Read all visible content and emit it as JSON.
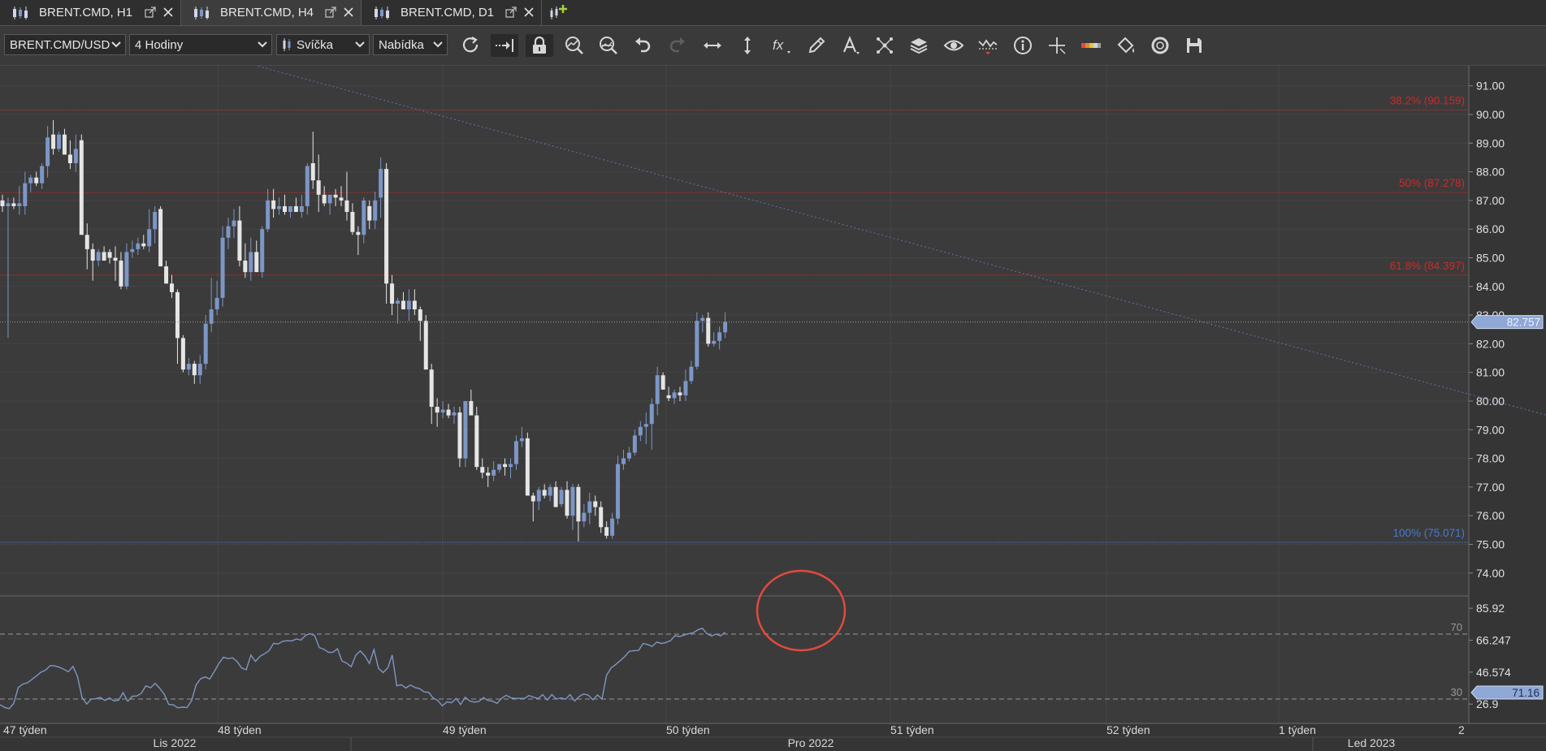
{
  "tabs": [
    {
      "label": "BRENT.CMD, H1",
      "active": false
    },
    {
      "label": "BRENT.CMD, H4",
      "active": true
    },
    {
      "label": "BRENT.CMD, D1",
      "active": false
    }
  ],
  "toolbar": {
    "instrument": "BRENT.CMD/USD",
    "period": "4 Hodiny",
    "chart_type": "Svíčka",
    "price_side": "Nabídka",
    "icons": [
      "refresh-icon",
      "autoshift-icon",
      "lock-icon",
      "zoom-in-icon",
      "zoom-out-icon",
      "undo-icon",
      "redo-icon",
      "horizontal-scale-icon",
      "vertical-scale-icon",
      "indicator-fx-icon",
      "pencil-icon",
      "text-tool-icon",
      "pattern-icon",
      "layers-icon",
      "eye-icon",
      "alert-icon",
      "info-icon",
      "crosshair-icon",
      "color-bar-icon",
      "paint-bucket-icon",
      "screenshot-icon",
      "save-icon"
    ]
  },
  "colors": {
    "background": "#3b3b3b",
    "bull_candle": "#7c96c6",
    "bear_candle": "#e5e5e5",
    "fib_red": "#cc2a2a",
    "fib_blue": "#4a78d1",
    "price_tag": "#8fa8d6",
    "annotation_circle": "#e04a3f",
    "rsi_line": "#7f96c2"
  },
  "chart_data": {
    "type": "candlestick",
    "instrument": "BRENT.CMD",
    "timeframe": "H4",
    "price_axis_ticks": [
      "91.00",
      "90.00",
      "89.00",
      "88.00",
      "87.00",
      "86.00",
      "85.00",
      "84.00",
      "83.00",
      "82.00",
      "81.00",
      "80.00",
      "79.00",
      "78.00",
      "77.00",
      "76.00",
      "75.00",
      "74.00"
    ],
    "ylim": [
      73.2,
      91.7
    ],
    "last_price": "82.757",
    "fibonacci": [
      {
        "label": "38.2% (90.159)",
        "value": 90.159,
        "color": "#cc2a2a"
      },
      {
        "label": "50% (87.278)",
        "value": 87.278,
        "color": "#cc2a2a"
      },
      {
        "label": "61.8% (84.397)",
        "value": 84.397,
        "color": "#cc2a2a"
      },
      {
        "label": "100% (75.071)",
        "value": 75.071,
        "color": "#4a78d1"
      }
    ],
    "trendline": {
      "from": {
        "bar": 30,
        "price": 92.5
      },
      "to": {
        "bar": 328,
        "price": 76.6
      }
    },
    "candles": [
      [
        87.0,
        87.2,
        86.6,
        86.8
      ],
      [
        86.8,
        87.1,
        82.2,
        86.9
      ],
      [
        86.9,
        87.1,
        86.7,
        86.8
      ],
      [
        86.8,
        87.5,
        86.5,
        86.9
      ],
      [
        86.8,
        88.0,
        86.5,
        87.6
      ],
      [
        87.6,
        87.9,
        87.3,
        87.8
      ],
      [
        87.8,
        88.0,
        87.5,
        87.6
      ],
      [
        87.6,
        88.3,
        87.4,
        88.2
      ],
      [
        88.2,
        89.6,
        87.8,
        89.2
      ],
      [
        89.3,
        89.8,
        88.6,
        88.8
      ],
      [
        88.8,
        89.4,
        88.7,
        89.3
      ],
      [
        89.3,
        89.5,
        88.9,
        88.6
      ],
      [
        88.6,
        89.1,
        88.1,
        88.3
      ],
      [
        88.3,
        89.3,
        88.0,
        88.8
      ],
      [
        89.1,
        89.3,
        88.0,
        85.8
      ],
      [
        85.8,
        86.2,
        84.6,
        85.3
      ],
      [
        85.3,
        85.5,
        84.2,
        84.9
      ],
      [
        84.9,
        85.3,
        84.7,
        85.2
      ],
      [
        85.2,
        85.4,
        84.9,
        84.9
      ],
      [
        85.2,
        85.3,
        84.8,
        85.0
      ],
      [
        85.0,
        85.4,
        84.2,
        84.9
      ],
      [
        84.9,
        85.2,
        83.9,
        84.0
      ],
      [
        84.0,
        85.5,
        83.9,
        85.2
      ],
      [
        85.2,
        85.6,
        85.0,
        85.3
      ],
      [
        85.3,
        85.7,
        85.1,
        85.5
      ],
      [
        85.5,
        85.8,
        85.3,
        85.4
      ],
      [
        85.4,
        86.7,
        85.2,
        86.0
      ],
      [
        86.0,
        86.8,
        85.5,
        86.6
      ],
      [
        86.7,
        86.8,
        85.3,
        84.7
      ],
      [
        84.7,
        84.9,
        84.1,
        84.1
      ],
      [
        84.1,
        84.4,
        83.6,
        83.8
      ],
      [
        83.8,
        83.9,
        81.3,
        82.2
      ],
      [
        82.2,
        82.3,
        81.0,
        81.1
      ],
      [
        81.1,
        81.5,
        80.9,
        81.3
      ],
      [
        81.3,
        81.4,
        80.6,
        80.9
      ],
      [
        80.9,
        81.6,
        80.6,
        81.3
      ],
      [
        81.3,
        83.0,
        81.1,
        82.7
      ],
      [
        82.7,
        84.3,
        82.4,
        83.2
      ],
      [
        83.2,
        84.2,
        83.0,
        83.6
      ],
      [
        83.6,
        86.1,
        83.3,
        85.7
      ],
      [
        85.7,
        86.4,
        85.3,
        86.1
      ],
      [
        86.1,
        86.7,
        85.7,
        86.3
      ],
      [
        86.3,
        86.8,
        84.7,
        84.9
      ],
      [
        84.9,
        85.5,
        84.3,
        84.5
      ],
      [
        84.5,
        85.7,
        84.2,
        85.2
      ],
      [
        85.2,
        85.6,
        84.6,
        84.5
      ],
      [
        84.5,
        86.1,
        84.3,
        86.0
      ],
      [
        86.0,
        87.4,
        85.9,
        87.0
      ],
      [
        87.0,
        87.4,
        86.4,
        86.7
      ],
      [
        86.7,
        87.1,
        86.5,
        86.8
      ],
      [
        86.8,
        87.2,
        86.5,
        86.6
      ],
      [
        86.6,
        86.8,
        86.4,
        86.8
      ],
      [
        86.8,
        87.1,
        86.6,
        86.6
      ],
      [
        86.6,
        87.2,
        86.4,
        86.8
      ],
      [
        86.8,
        88.3,
        86.5,
        88.2
      ],
      [
        88.3,
        89.4,
        87.4,
        87.7
      ],
      [
        87.7,
        88.6,
        86.6,
        87.2
      ],
      [
        87.2,
        87.5,
        86.8,
        86.9
      ],
      [
        86.9,
        87.1,
        86.5,
        87.2
      ],
      [
        87.2,
        87.4,
        86.8,
        87.1
      ],
      [
        87.1,
        87.5,
        86.8,
        87.0
      ],
      [
        87.0,
        88.0,
        86.3,
        86.6
      ],
      [
        86.6,
        86.9,
        85.8,
        85.9
      ],
      [
        85.9,
        86.1,
        85.1,
        85.8
      ],
      [
        85.8,
        87.1,
        85.5,
        87.0
      ],
      [
        86.8,
        87.0,
        86.0,
        86.3
      ],
      [
        86.3,
        87.3,
        86.0,
        87.0
      ],
      [
        87.1,
        88.5,
        86.4,
        88.1
      ],
      [
        88.1,
        88.3,
        83.4,
        84.1
      ],
      [
        84.1,
        84.4,
        83.0,
        83.4
      ],
      [
        83.4,
        83.6,
        82.7,
        83.5
      ],
      [
        83.5,
        83.8,
        83.3,
        83.2
      ],
      [
        83.2,
        83.9,
        82.8,
        83.5
      ],
      [
        83.5,
        83.9,
        83.0,
        83.2
      ],
      [
        83.2,
        83.3,
        82.1,
        82.8
      ],
      [
        82.8,
        83.0,
        81.3,
        81.1
      ],
      [
        81.1,
        81.3,
        79.2,
        79.8
      ],
      [
        79.8,
        80.1,
        79.1,
        79.6
      ],
      [
        79.6,
        80.0,
        79.4,
        79.7
      ],
      [
        79.7,
        79.9,
        79.4,
        79.5
      ],
      [
        79.5,
        79.8,
        79.2,
        79.6
      ],
      [
        79.6,
        79.8,
        77.7,
        78.0
      ],
      [
        78.0,
        80.0,
        77.7,
        80.0
      ],
      [
        80.0,
        80.4,
        79.7,
        79.5
      ],
      [
        79.5,
        79.8,
        77.6,
        77.7
      ],
      [
        77.7,
        78.0,
        77.3,
        77.5
      ],
      [
        77.5,
        77.7,
        77.0,
        77.4
      ],
      [
        77.4,
        77.9,
        77.2,
        77.6
      ],
      [
        77.6,
        77.8,
        77.5,
        77.8
      ],
      [
        77.8,
        78.0,
        77.4,
        77.7
      ],
      [
        77.7,
        78.0,
        77.3,
        77.8
      ],
      [
        77.8,
        78.8,
        77.6,
        78.6
      ],
      [
        78.6,
        79.1,
        78.4,
        78.7
      ],
      [
        78.7,
        78.9,
        77.5,
        76.7
      ],
      [
        76.7,
        76.8,
        75.8,
        76.5
      ],
      [
        76.5,
        77.0,
        76.2,
        76.9
      ],
      [
        76.9,
        77.1,
        76.6,
        76.7
      ],
      [
        76.7,
        77.1,
        76.5,
        77.0
      ],
      [
        77.0,
        77.2,
        76.4,
        76.3
      ],
      [
        76.4,
        77.0,
        76.3,
        76.9
      ],
      [
        76.9,
        77.2,
        75.9,
        76.0
      ],
      [
        76.0,
        77.1,
        75.5,
        77.0
      ],
      [
        77.0,
        77.1,
        75.1,
        75.8
      ],
      [
        75.8,
        76.4,
        75.6,
        76.1
      ],
      [
        76.1,
        76.8,
        75.7,
        76.5
      ],
      [
        76.5,
        76.7,
        76.0,
        76.3
      ],
      [
        76.3,
        76.5,
        75.4,
        75.6
      ],
      [
        75.6,
        75.8,
        75.2,
        75.3
      ],
      [
        75.3,
        76.1,
        75.2,
        75.9
      ],
      [
        75.9,
        78.1,
        75.7,
        77.8
      ],
      [
        77.8,
        78.3,
        77.6,
        78.0
      ],
      [
        78.0,
        78.4,
        77.9,
        78.2
      ],
      [
        78.2,
        79.0,
        78.1,
        78.8
      ],
      [
        78.8,
        79.3,
        78.6,
        79.1
      ],
      [
        79.1,
        79.6,
        78.5,
        79.2
      ],
      [
        79.2,
        80.1,
        78.3,
        79.9
      ],
      [
        79.9,
        81.2,
        79.5,
        80.9
      ],
      [
        80.9,
        81.0,
        80.4,
        80.4
      ],
      [
        80.2,
        80.5,
        80.0,
        80.1
      ],
      [
        80.1,
        80.4,
        79.9,
        80.3
      ],
      [
        80.3,
        80.5,
        80.0,
        80.2
      ],
      [
        80.2,
        81.1,
        80.0,
        80.7
      ],
      [
        80.7,
        81.4,
        80.6,
        81.2
      ],
      [
        81.2,
        83.1,
        81.1,
        82.8
      ],
      [
        82.8,
        83.0,
        82.4,
        82.9
      ],
      [
        82.9,
        83.1,
        81.9,
        82.0
      ],
      [
        82.0,
        82.4,
        81.9,
        82.1
      ],
      [
        82.1,
        82.6,
        81.8,
        82.4
      ],
      [
        82.4,
        83.1,
        82.2,
        82.76
      ]
    ],
    "rsi": {
      "name": "RSI",
      "axis_ticks": [
        "85.92",
        "66.247",
        "46.574",
        "26.9"
      ],
      "levels": [
        70,
        30
      ],
      "last": "71.16",
      "values": [
        26.5,
        24.9,
        24.1,
        27.2,
        37.1,
        39.2,
        40.0,
        42.1,
        44.3,
        46.6,
        47.8,
        50.6,
        50.4,
        49.6,
        48.3,
        46.8,
        50.1,
        43.9,
        30.9,
        26.9,
        29.9,
        30.2,
        31.0,
        29.1,
        30.7,
        28.8,
        29.3,
        33.9,
        28.6,
        31.7,
        31.9,
        33.6,
        38.1,
        36.9,
        39.6,
        36.7,
        33.0,
        26.7,
        26.4,
        24.6,
        25.0,
        24.8,
        29.0,
        38.7,
        42.5,
        43.6,
        42.3,
        47.0,
        52.0,
        55.8,
        54.9,
        55.4,
        53.1,
        49.1,
        48.0,
        57.1,
        53.2,
        56.3,
        57.9,
        59.8,
        64.3,
        63.9,
        65.6,
        65.9,
        65.8,
        67.0,
        66.3,
        69.2,
        70.3,
        69.0,
        61.7,
        60.7,
        58.8,
        58.8,
        61.0,
        53.4,
        52.1,
        49.9,
        57.0,
        59.6,
        56.6,
        51.9,
        60.5,
        48.9,
        46.3,
        49.1,
        57.1,
        38.2,
        38.8,
        36.8,
        38.6,
        37.1,
        36.4,
        34.4,
        34.1,
        30.6,
        29.1,
        25.8,
        28.3,
        27.7,
        30.4,
        26.6,
        31.1,
        28.8,
        28.1,
        28.5,
        30.9,
        29.1,
        28.7,
        27.3,
        30.5,
        32.3,
        30.8,
        30.4,
        30.4,
        30.4,
        32.2,
        31.1,
        30.3,
        32.7,
        29.4,
        32.8,
        30.0,
        30.7,
        29.9,
        32.7,
        28.8,
        31.6,
        33.1,
        32.4,
        29.5,
        32.5,
        30.0,
        44.6,
        49.2,
        51.3,
        53.7,
        56.2,
        59.4,
        59.8,
        59.9,
        64.2,
        63.6,
        62.4,
        65.1,
        64.2,
        64.8,
        65.9,
        69.0,
        68.5,
        69.4,
        70.2,
        70.8,
        72.6,
        73.6,
        70.3,
        68.8,
        70.0,
        68.9,
        71.16
      ]
    },
    "time_axis": {
      "weeks": [
        "47 týden",
        "48 týden",
        "49 týden",
        "50 týden",
        "51 týden",
        "52 týden",
        "1 týden",
        "2"
      ],
      "months": [
        "Lis 2022",
        "Pro 2022",
        "Led 2023"
      ]
    }
  }
}
